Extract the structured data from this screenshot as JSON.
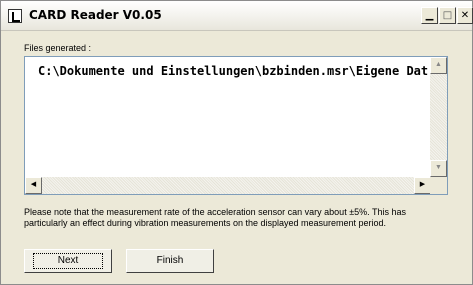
{
  "window": {
    "title": "CARD Reader  V0.05",
    "minimize_glyph": "▁",
    "maximize_glyph": "□",
    "close_glyph": "✕"
  },
  "files": {
    "label": "Files generated :",
    "path_text": "C:\\Dokumente und Einstellungen\\bzbinden.msr\\Eigene Dat"
  },
  "scroll": {
    "up": "▲",
    "down": "▼",
    "left": "◀",
    "right": "▶"
  },
  "note": "Please note that the measurement rate of the acceleration sensor can vary about ±5%. This has particularly an effect during vibration measurements on the displayed measurement period.",
  "buttons": {
    "next": "Next",
    "finish": "Finish"
  }
}
